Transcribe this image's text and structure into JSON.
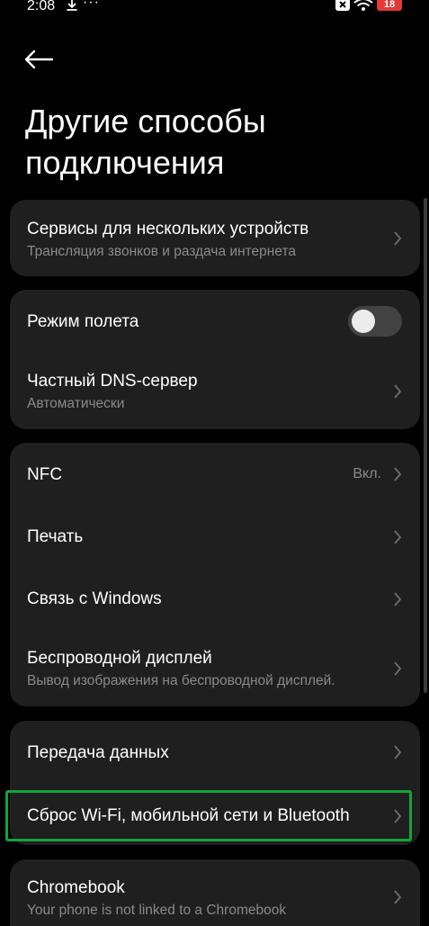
{
  "status": {
    "time": "2:08",
    "more": "···",
    "battery": "18"
  },
  "title": "Другие способы подключения",
  "groups": {
    "multi_device": {
      "title": "Сервисы для нескольких устройств",
      "subtitle": "Трансляция звонков и раздача интернета"
    },
    "airplane": {
      "title": "Режим полета",
      "toggle_on": false
    },
    "dns": {
      "title": "Частный DNS-сервер",
      "subtitle": "Автоматически"
    },
    "nfc": {
      "title": "NFC",
      "value": "Вкл."
    },
    "print": {
      "title": "Печать"
    },
    "windows": {
      "title": "Связь с Windows"
    },
    "wireless_display": {
      "title": "Беспроводной дисплей",
      "subtitle": "Вывод изображения на беспроводной дисплей."
    },
    "data_transfer": {
      "title": "Передача данных"
    },
    "reset": {
      "title": "Сброс Wi-Fi, мобильной сети и Bluetooth"
    },
    "chromebook": {
      "title": "Chromebook",
      "subtitle": "Your phone is not linked to a Chromebook"
    }
  },
  "colors": {
    "background": "#000000",
    "card": "#1f1f1f",
    "secondary_text": "#8a8a8a",
    "highlight": "#14a33a",
    "battery": "#e53935"
  }
}
